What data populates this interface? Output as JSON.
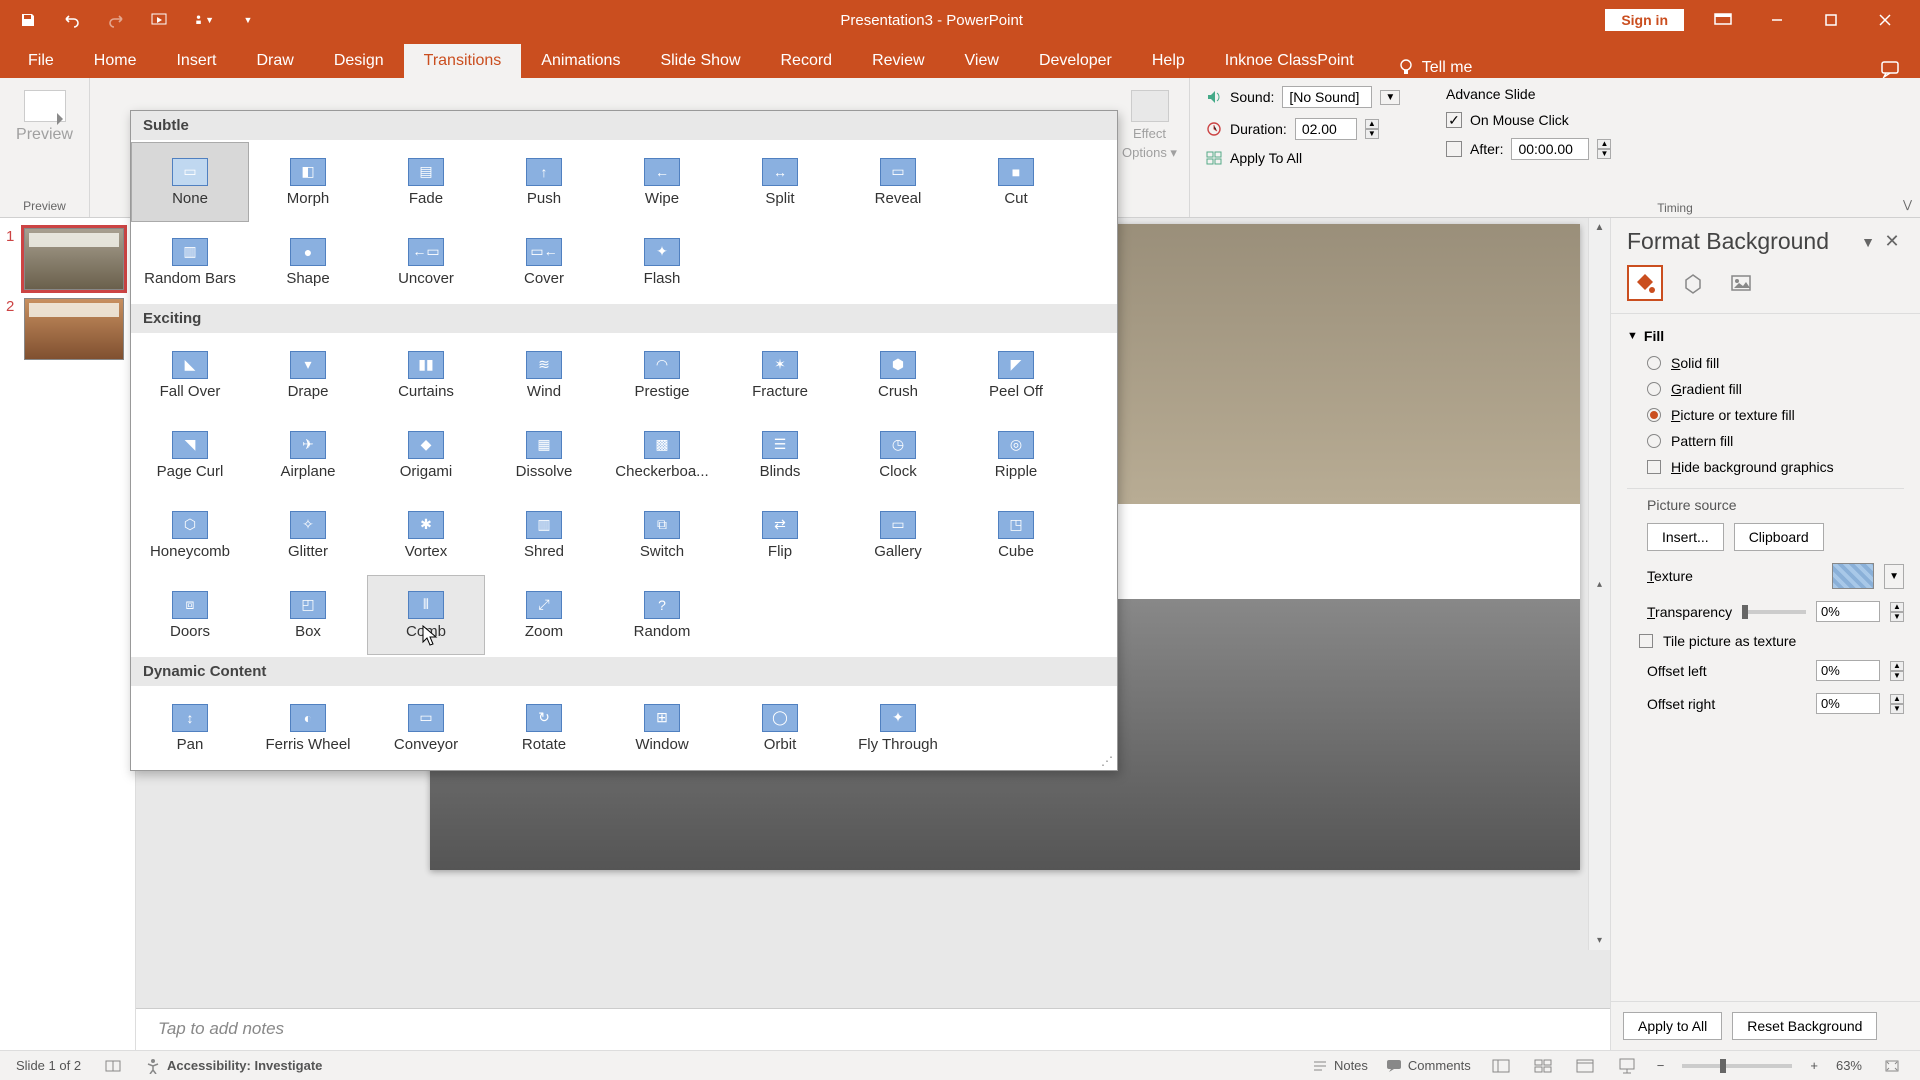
{
  "title": "Presentation3  -  PowerPoint",
  "signin": "Sign in",
  "tabs": [
    "File",
    "Home",
    "Insert",
    "Draw",
    "Design",
    "Transitions",
    "Animations",
    "Slide Show",
    "Record",
    "Review",
    "View",
    "Developer",
    "Help",
    "Inknoe ClassPoint"
  ],
  "active_tab": "Transitions",
  "tell_me": "Tell me",
  "ribbon": {
    "preview_group": "Preview",
    "preview_btn": "Preview",
    "effect_options": "Effect Options ▾",
    "effect_options_line1": "Effect",
    "effect_options_line2": "Options ▾",
    "sound_label": "Sound:",
    "sound_value": "[No Sound]",
    "duration_label": "Duration:",
    "duration_value": "02.00",
    "apply_all": "Apply To All",
    "advance_slide": "Advance Slide",
    "on_mouse_click": "On Mouse Click",
    "after_label": "After:",
    "after_value": "00:00.00",
    "timing_group": "Timing"
  },
  "gallery": {
    "categories": [
      {
        "name": "Subtle",
        "items": [
          "None",
          "Morph",
          "Fade",
          "Push",
          "Wipe",
          "Split",
          "Reveal",
          "Cut",
          "Random Bars",
          "Shape",
          "Uncover",
          "Cover",
          "Flash"
        ]
      },
      {
        "name": "Exciting",
        "items": [
          "Fall Over",
          "Drape",
          "Curtains",
          "Wind",
          "Prestige",
          "Fracture",
          "Crush",
          "Peel Off",
          "Page Curl",
          "Airplane",
          "Origami",
          "Dissolve",
          "Checkerboa...",
          "Blinds",
          "Clock",
          "Ripple",
          "Honeycomb",
          "Glitter",
          "Vortex",
          "Shred",
          "Switch",
          "Flip",
          "Gallery",
          "Cube",
          "Doors",
          "Box",
          "Comb",
          "Zoom",
          "Random"
        ]
      },
      {
        "name": "Dynamic Content",
        "items": [
          "Pan",
          "Ferris Wheel",
          "Conveyor",
          "Rotate",
          "Window",
          "Orbit",
          "Fly Through"
        ]
      }
    ],
    "selected": "None",
    "hovered": "Comb"
  },
  "pane": {
    "title": "Format Background",
    "section_fill": "Fill",
    "solid_fill": "Solid fill",
    "gradient_fill": "Gradient fill",
    "picture_fill": "Picture or texture fill",
    "pattern_fill": "Pattern fill",
    "hide_bg": "Hide background graphics",
    "picture_source": "Picture source",
    "insert_btn": "Insert...",
    "clipboard_btn": "Clipboard",
    "texture_label": "Texture",
    "transparency_label": "Transparency",
    "transparency_value": "0%",
    "tile_label": "Tile picture as texture",
    "offset_left": "Offset left",
    "offset_left_val": "0%",
    "offset_right": "Offset right",
    "offset_right_val": "0%",
    "apply_all_btn": "Apply to All",
    "reset_btn": "Reset Background"
  },
  "notes_placeholder": "Tap to add notes",
  "status": {
    "slide": "Slide 1 of 2",
    "accessibility": "Accessibility: Investigate",
    "notes_btn": "Notes",
    "comments_btn": "Comments",
    "zoom": "63%"
  },
  "slides": [
    1,
    2
  ]
}
